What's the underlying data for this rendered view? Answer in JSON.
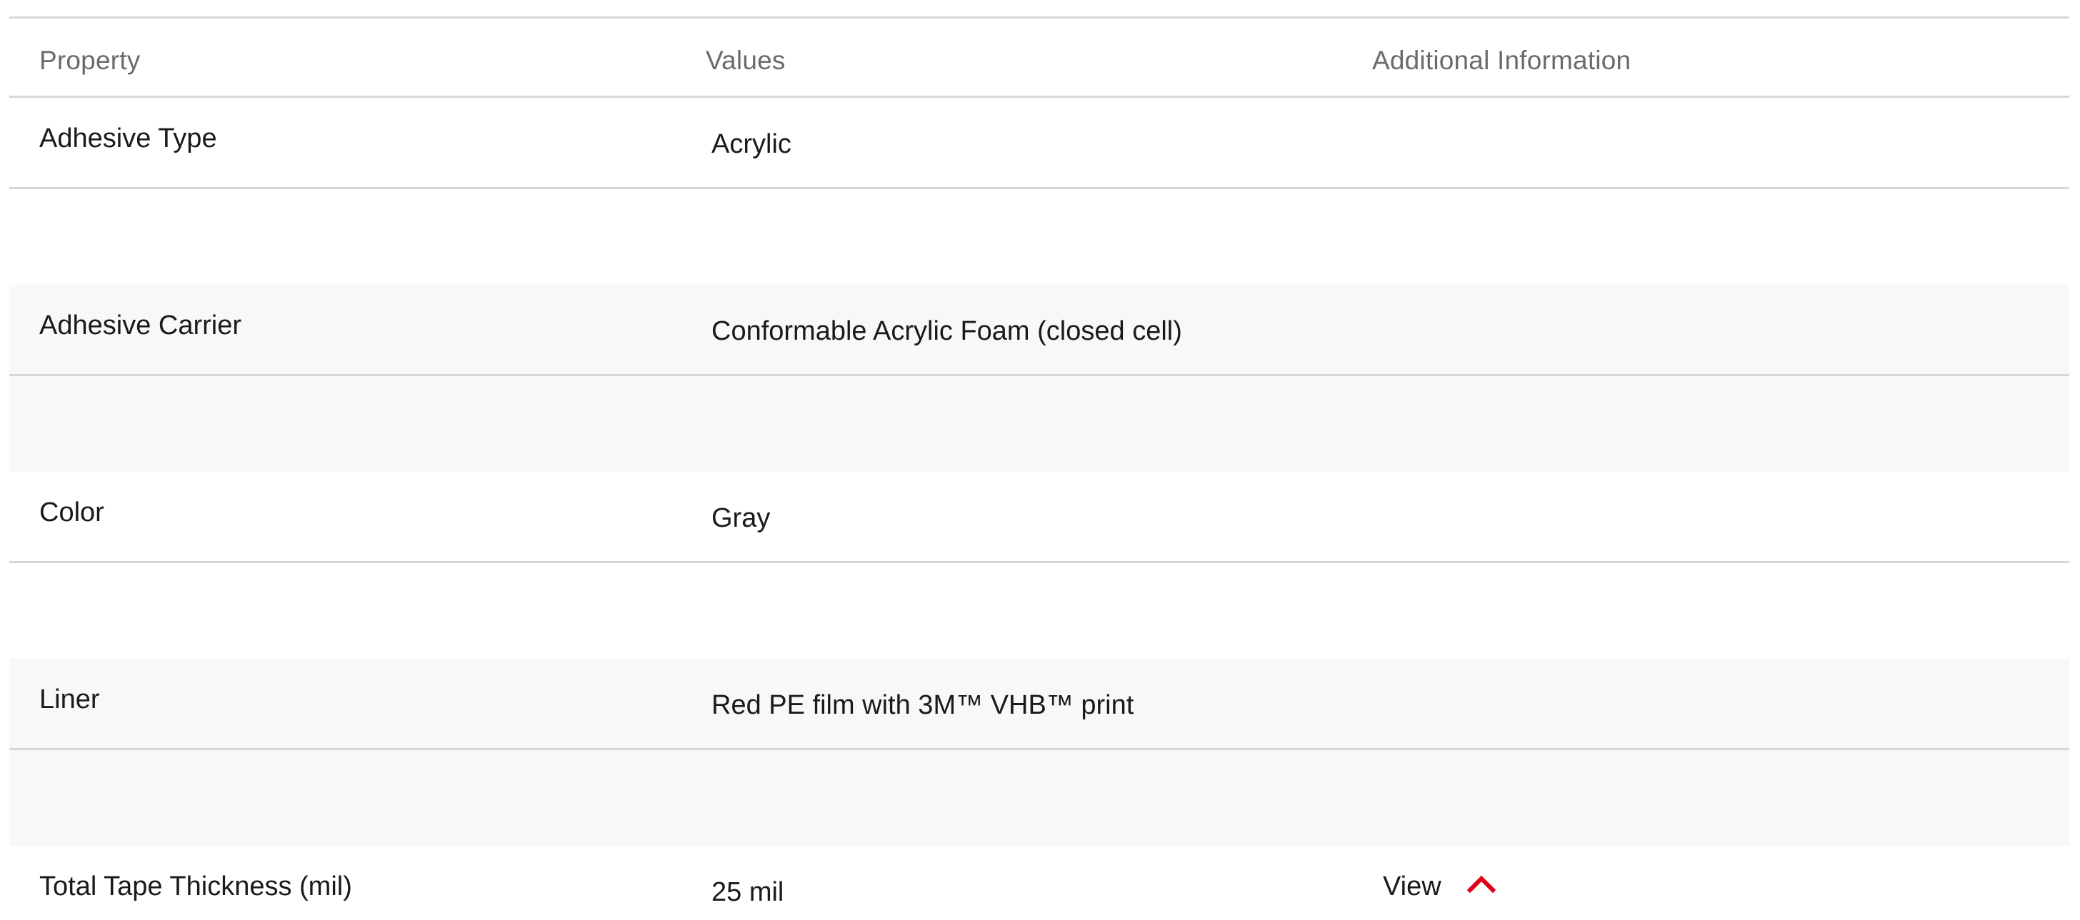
{
  "table": {
    "headers": {
      "property": "Property",
      "values": "Values",
      "additional": "Additional Information"
    },
    "rows": [
      {
        "property": "Adhesive Type",
        "value": "Acrylic",
        "additional": ""
      },
      {
        "property": "Adhesive Carrier",
        "value": "Conformable Acrylic Foam (closed cell)",
        "additional": ""
      },
      {
        "property": "Color",
        "value": "Gray",
        "additional": ""
      },
      {
        "property": "Liner",
        "value": "Red PE film with 3M™ VHB™ print",
        "additional": ""
      },
      {
        "property": "Total Tape Thickness (mil)",
        "value": "25 mil",
        "additional": "View"
      }
    ]
  },
  "icons": {
    "expand_toggle": "chevron-up-icon"
  },
  "colors": {
    "accent": "#e1001a",
    "alt_row_bg": "#f8f8f8",
    "divider": "#d7d7d7",
    "header_text": "#6b6b6b"
  }
}
